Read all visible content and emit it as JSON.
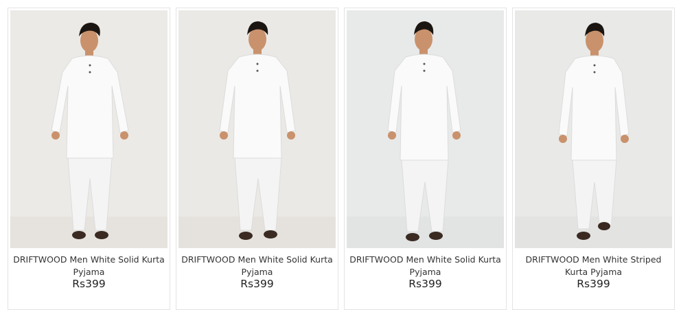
{
  "products": [
    {
      "name": "DRIFTWOOD Men White Solid Kurta Pyjama",
      "price": "Rs399",
      "image_icon": "model-white-kurta-photo"
    },
    {
      "name": "DRIFTWOOD Men White Solid Kurta Pyjama",
      "price": "Rs399",
      "image_icon": "model-white-kurta-photo"
    },
    {
      "name": "DRIFTWOOD Men White Solid Kurta Pyjama",
      "price": "Rs399",
      "image_icon": "model-white-kurta-photo"
    },
    {
      "name": "DRIFTWOOD Men White Striped Kurta Pyjama",
      "price": "Rs399",
      "image_icon": "model-white-kurta-photo"
    }
  ],
  "colors": {
    "photo_bg_warm": "#eceae6",
    "photo_bg_cool": "#e9eaea",
    "garment": "#fafafa",
    "skin": "#c9926c",
    "hair": "#1b1512",
    "sandal": "#3a2a22"
  }
}
